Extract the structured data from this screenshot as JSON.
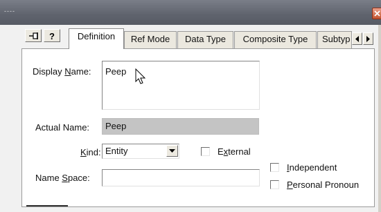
{
  "window": {
    "title": "----"
  },
  "toolbar": {
    "pin_icon": "pin-icon",
    "help_icon": "help-icon"
  },
  "tabs": [
    {
      "label": "Definition",
      "active": true
    },
    {
      "label": "Ref Mode",
      "active": false
    },
    {
      "label": "Data Type",
      "active": false
    },
    {
      "label": "Composite Type",
      "active": false
    },
    {
      "label": "Subtyp",
      "active": false
    }
  ],
  "form": {
    "display_name": {
      "label_pre": "Display ",
      "label_accel": "N",
      "label_post": "ame:",
      "value": "Peep"
    },
    "actual_name": {
      "label": "Actual Name:",
      "value": "Peep"
    },
    "kind": {
      "label_pre": "",
      "label_accel": "K",
      "label_post": "ind:",
      "value": "Entity"
    },
    "external": {
      "label_pre": "E",
      "label_accel": "x",
      "label_post": "ternal",
      "checked": false
    },
    "name_space": {
      "label_pre": "Name ",
      "label_accel": "S",
      "label_post": "pace:",
      "value": ""
    },
    "independent": {
      "label_pre": "",
      "label_accel": "I",
      "label_post": "ndependent",
      "checked": false
    },
    "personal_pronoun": {
      "label_pre": "",
      "label_accel": "P",
      "label_post": "ersonal Pronoun",
      "checked": false
    }
  },
  "colors": {
    "titlebar": "#5f636d",
    "close": "#c4552f",
    "readonly_field": "#c4c4c4"
  }
}
